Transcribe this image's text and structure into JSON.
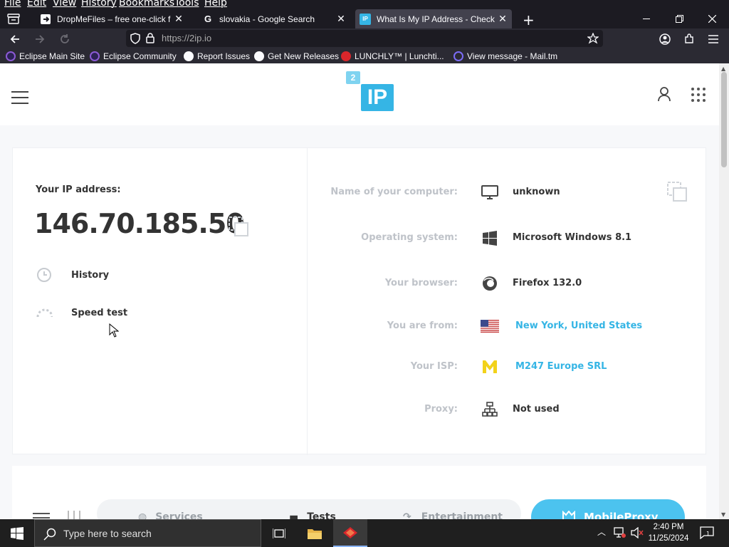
{
  "menu": [
    "File",
    "Edit",
    "View",
    "History",
    "Bookmarks",
    "Tools",
    "Help"
  ],
  "tabs": [
    {
      "title": "DropMeFiles – free one-click file sharing",
      "active": false
    },
    {
      "title": "slovakia - Google Search",
      "active": false
    },
    {
      "title": "What Is My IP Address - Check your IP",
      "active": true
    }
  ],
  "url": "https://2ip.io",
  "bookmarks": [
    "Eclipse Main Site",
    "Eclipse Community",
    "Report Issues",
    "Get New Releases",
    "LUNCHLY™ | Lunchti...",
    "View message - Mail.tm"
  ],
  "site": {
    "logo_small": "2",
    "logo_big": "IP",
    "ip_label": "Your IP address:",
    "ip_value": "146.70.185.50",
    "links": [
      {
        "label": "History",
        "icon": "history-icon"
      },
      {
        "label": "Speed test",
        "icon": "speedometer-icon"
      }
    ],
    "info": [
      {
        "key": "Name of your computer:",
        "value": "unknown",
        "icon": "monitor-icon"
      },
      {
        "key": "Operating system:",
        "value": "Microsoft Windows 8.1",
        "icon": "windows-icon"
      },
      {
        "key": "Your browser:",
        "value": "Firefox 132.0",
        "icon": "firefox-icon"
      },
      {
        "key": "You are from:",
        "value": "New York, United States",
        "icon": "us-flag-icon"
      },
      {
        "key": "Your ISP:",
        "value": "M247 Europe SRL",
        "icon": "isp-logo-icon"
      },
      {
        "key": "Proxy:",
        "value": "Not used",
        "icon": "network-icon"
      }
    ],
    "subnav": [
      "Services",
      "Tests",
      "Entertainment"
    ],
    "mobileproxy": "MobileProxy"
  },
  "taskbar": {
    "search_placeholder": "Type here to search",
    "time": "2:40 PM",
    "date": "11/25/2024",
    "notif_count": "1"
  },
  "colors": {
    "accent": "#35b5e5",
    "chrome": "#1c1b22",
    "page_bg": "#f7f8fa"
  }
}
